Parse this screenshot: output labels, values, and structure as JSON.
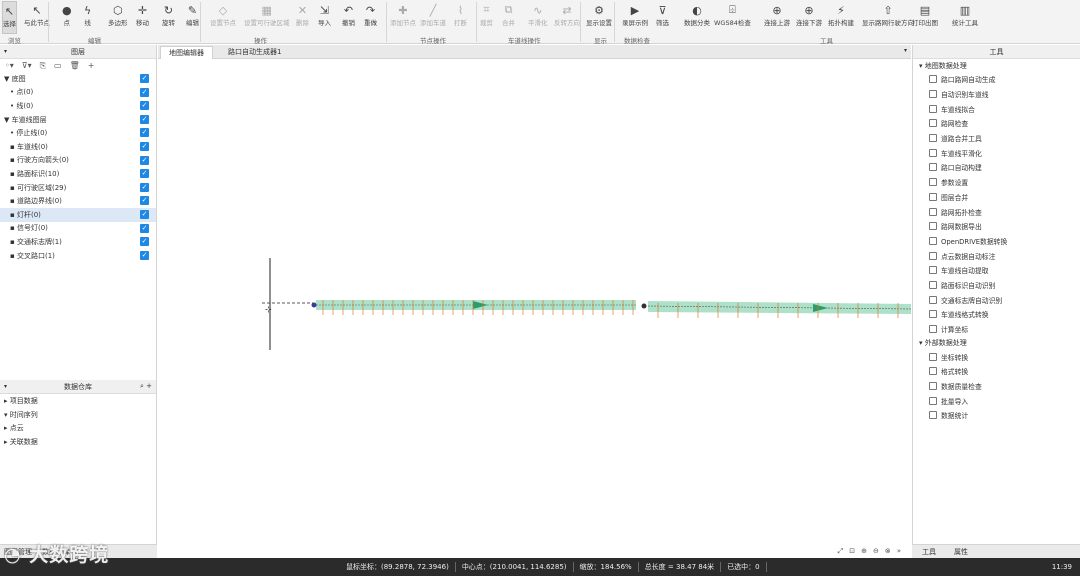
{
  "ribbon": {
    "buttons": [
      {
        "label": "选择",
        "icon": "cursor-icon"
      },
      {
        "label": "与此节点",
        "icon": "cursor-plus-icon"
      },
      {
        "label": "点",
        "icon": "point-icon"
      },
      {
        "label": "线",
        "icon": "line-icon"
      },
      {
        "label": "多边形",
        "icon": "polygon-icon"
      },
      {
        "label": "移动",
        "icon": "move-icon"
      },
      {
        "label": "旋转",
        "icon": "rotate-icon"
      },
      {
        "label": "编辑",
        "icon": "edit-icon"
      },
      {
        "label": "设置节点",
        "icon": "node-icon"
      },
      {
        "label": "设置可行驶区域",
        "icon": "area-icon"
      },
      {
        "label": "删除",
        "icon": "delete-icon"
      },
      {
        "label": "导入",
        "icon": "import-icon"
      },
      {
        "label": "撤销",
        "icon": "undo-icon"
      },
      {
        "label": "重做",
        "icon": "redo-icon"
      },
      {
        "label": "添加节点",
        "icon": "add-node-icon"
      },
      {
        "label": "添加车道",
        "icon": "add-lane-icon"
      },
      {
        "label": "打断",
        "icon": "break-icon"
      },
      {
        "label": "裁剪",
        "icon": "crop-icon"
      },
      {
        "label": "合并",
        "icon": "merge-icon"
      },
      {
        "label": "平滑化",
        "icon": "smooth-icon"
      },
      {
        "label": "反转方向",
        "icon": "reverse-icon"
      },
      {
        "label": "显示设置",
        "icon": "display-settings-icon"
      },
      {
        "label": "录屏示例",
        "icon": "record-icon"
      },
      {
        "label": "筛选",
        "icon": "filter-icon"
      },
      {
        "label": "数据分类",
        "icon": "classify-icon"
      },
      {
        "label": "WGS84检查",
        "icon": "check-icon"
      },
      {
        "label": "连接上游",
        "icon": "connect-up-icon"
      },
      {
        "label": "连接下游",
        "icon": "connect-down-icon"
      },
      {
        "label": "拓扑构建",
        "icon": "topology-icon"
      },
      {
        "label": "显示路网行驶方向",
        "icon": "direction-icon"
      },
      {
        "label": "打印出图",
        "icon": "print-icon"
      },
      {
        "label": "统计工具",
        "icon": "stats-icon"
      }
    ],
    "groups": [
      "浏览",
      "编辑",
      "操作",
      "节点操作",
      "车道线操作",
      "显示",
      "数据检查",
      "工具"
    ]
  },
  "layers_panel": {
    "title": "图层",
    "rows": [
      {
        "label": "▼ 底图",
        "indent": 0
      },
      {
        "label": "• 点(0)",
        "indent": 1
      },
      {
        "label": "• 线(0)",
        "indent": 1
      },
      {
        "label": "▼ 车道线图层",
        "indent": 0
      },
      {
        "label": "• 停止线(0)",
        "indent": 1
      },
      {
        "label": "▪ 车道线(0)",
        "indent": 1
      },
      {
        "label": "▪ 行驶方向箭头(0)",
        "indent": 1
      },
      {
        "label": "▪ 路面标识(10)",
        "indent": 1
      },
      {
        "label": "▪ 可行驶区域(29)",
        "indent": 1
      },
      {
        "label": "▪ 道路边界线(0)",
        "indent": 1
      },
      {
        "label": "▪ 灯杆(0)",
        "indent": 1
      },
      {
        "label": "▪ 信号灯(0)",
        "indent": 1
      },
      {
        "label": "▪ 交通标志牌(1)",
        "indent": 1
      },
      {
        "label": "▪ 交叉路口(1)",
        "indent": 1
      }
    ],
    "selected_index": 10
  },
  "data_panel": {
    "title": "数据仓库",
    "rows": [
      "▸ 项目数据",
      "▾ 时间序列",
      "  ▸ 点云",
      "▸ 关联数据"
    ]
  },
  "left_bottom_tabs": [
    "图层管理",
    "数据仓库"
  ],
  "doc_tabs": [
    "地图编辑器",
    "路口自动生成器1"
  ],
  "canvas": {
    "zoom_icons": [
      "⤢",
      "⊡",
      "⊕",
      "⊖",
      "⊗",
      "»"
    ]
  },
  "tools_panel": {
    "title": "工具",
    "sections": [
      {
        "title": "▾ 地图数据处理",
        "items": [
          "路口路网自动生成",
          "自动识别车道线",
          "车道线拟合",
          "路网检查",
          "道路合并工具",
          "车道线平滑化",
          "路口自动构建",
          "参数设置",
          "图层合并",
          "路网拓扑检查",
          "路网数据导出",
          "OpenDRIVE数据转换",
          "点云数据自动标注",
          "车道线自动提取",
          "路面标识自动识别",
          "交通标志牌自动识别",
          "车道线格式转换",
          "计算坐标"
        ]
      },
      {
        "title": "▾ 外部数据处理",
        "items": [
          "坐标转换",
          "格式转换",
          "数据质量检查",
          "批量导入",
          "数据统计"
        ]
      }
    ]
  },
  "right_bottom_tabs": [
    "工具",
    "属性"
  ],
  "status": {
    "mouse": "鼠标坐标：(89.2878, 72.3946)",
    "center": "中心点：(210.0041, 114.6285)",
    "scale": "缩放：184.56%",
    "length": "总长度 = 38.47 84米",
    "selected": "已选中：0",
    "time": "11:39"
  },
  "watermark": "大数跨境"
}
